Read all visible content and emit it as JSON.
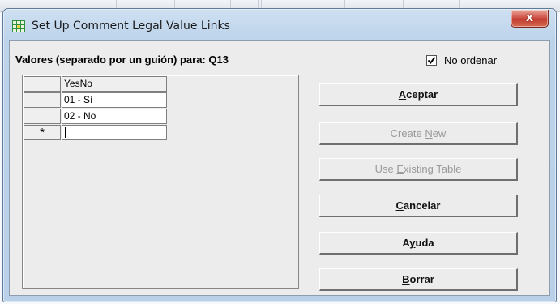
{
  "window": {
    "title": "Set Up Comment Legal Value Links",
    "close_glyph": "x"
  },
  "dialog": {
    "prompt": "Valores (separado por un guión) para: Q13",
    "no_ordenar": {
      "label": "No ordenar",
      "checked": true
    },
    "grid": {
      "header": "YesNo",
      "rows": [
        "01 - Sí",
        "02 - No"
      ],
      "new_row_marker": "*",
      "new_row_value": ""
    },
    "buttons": {
      "aceptar": {
        "pre": "",
        "key": "A",
        "post": "ceptar",
        "enabled": true
      },
      "create_new": {
        "pre": "Create ",
        "key": "N",
        "post": "ew",
        "enabled": false
      },
      "use_existing": {
        "pre": "Use ",
        "key": "E",
        "post": "xisting Table",
        "enabled": false
      },
      "cancelar": {
        "pre": "",
        "key": "C",
        "post": "ancelar",
        "enabled": true
      },
      "ayuda": {
        "pre": "A",
        "key": "y",
        "post": "uda",
        "enabled": true
      },
      "borrar": {
        "pre": "",
        "key": "B",
        "post": "orrar",
        "enabled": true
      }
    }
  },
  "icons": {
    "app": "spreadsheet-grid-icon",
    "checkmark": "checkmark-icon"
  },
  "colors": {
    "window_frame": "#bcd3ea",
    "close_button": "#c23d30",
    "disabled_text": "#9a9a9a"
  }
}
